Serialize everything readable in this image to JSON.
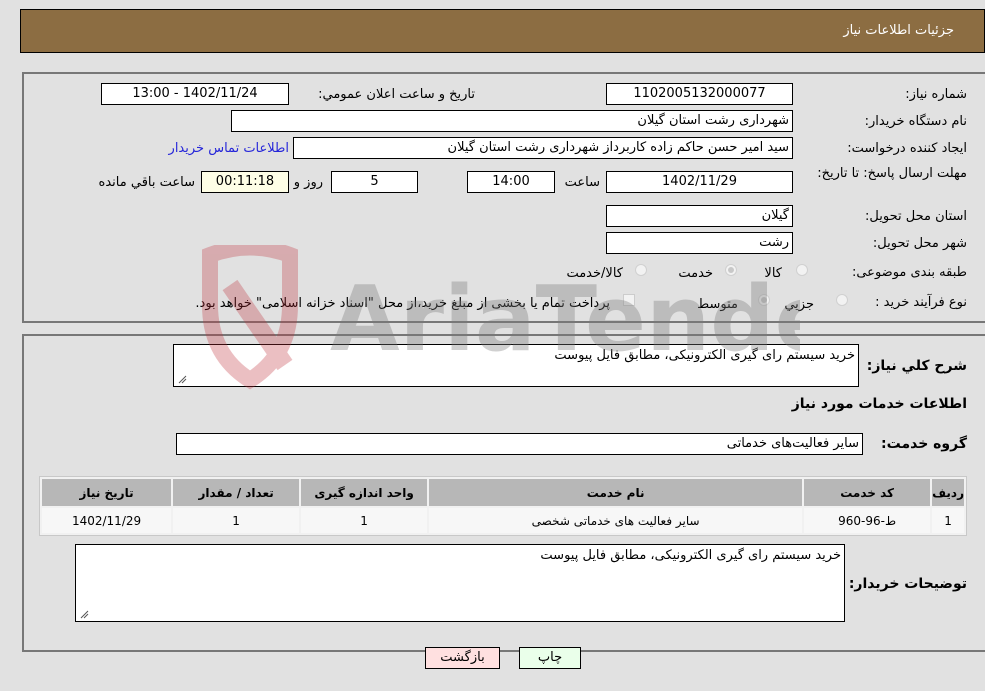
{
  "header": {
    "title": "جزئیات اطلاعات نیاز"
  },
  "details": {
    "need_number_label": "شماره نیاز:",
    "need_number": "1102005132000077",
    "announce_label": "تاریخ و ساعت اعلان عمومي:",
    "announce_value": "1402/11/24 - 13:00",
    "buyer_org_label": "نام دستگاه خریدار:",
    "buyer_org": "شهرداری رشت استان گیلان",
    "creator_label": "ایجاد کننده درخواست:",
    "creator": "سید امیر حسن حاکم زاده کاربرداز  شهرداری رشت استان گیلان",
    "contact_link": "اطلاعات تماس خریدار",
    "deadline_label": "مهلت ارسال پاسخ: تا تاریخ:",
    "deadline_date": "1402/11/29",
    "time_label": "ساعت",
    "deadline_time": "14:00",
    "days_value": "5",
    "days_label": "روز و",
    "remaining_time": "00:11:18",
    "remaining_label": "ساعت باقي مانده",
    "province_label": "استان محل تحویل:",
    "province": "گیلان",
    "city_label": "شهر محل تحویل:",
    "city": "رشت",
    "category_label": "طبقه بندی موضوعی:",
    "category_options": [
      {
        "label": "کالا",
        "checked": false
      },
      {
        "label": "خدمت",
        "checked": true
      },
      {
        "label": "کالا/خدمت",
        "checked": false
      }
    ],
    "purchase_type_label": "نوع فرآیند خرید :",
    "purchase_options": [
      {
        "label": "جزیي",
        "checked": false
      },
      {
        "label": "متوسط",
        "checked": true
      }
    ],
    "treasury_note": "پرداخت تمام یا بخشی از مبلغ خرید،از محل \"اسناد خزانه اسلامی\" خواهد بود."
  },
  "services": {
    "description_label": "شرح کلي نیاز:",
    "description": "خرید سیستم رای گیری الکترونیکی، مطابق فایل پیوست",
    "section_title": "اطلاعات خدمات مورد نیاز",
    "group_label": "گروه خدمت:",
    "group_value": "سایر فعالیت‌های خدماتی",
    "table": {
      "headers": [
        "ردیف",
        "کد خدمت",
        "نام خدمت",
        "واحد اندازه گیری",
        "تعداد / مقدار",
        "تاریخ نیاز"
      ],
      "rows": [
        [
          "1",
          "ط-96-960",
          "سایر فعالیت های خدماتی شخصی",
          "1",
          "1",
          "1402/11/29"
        ]
      ]
    },
    "buyer_notes_label": "توضیحات خریدار:",
    "buyer_notes": "خرید سیستم رای گیری الکترونیکی، مطابق فایل پیوست"
  },
  "buttons": {
    "print": "چاپ",
    "back": "بازگشت"
  },
  "watermark": {
    "text": "AriaTender.neT"
  }
}
